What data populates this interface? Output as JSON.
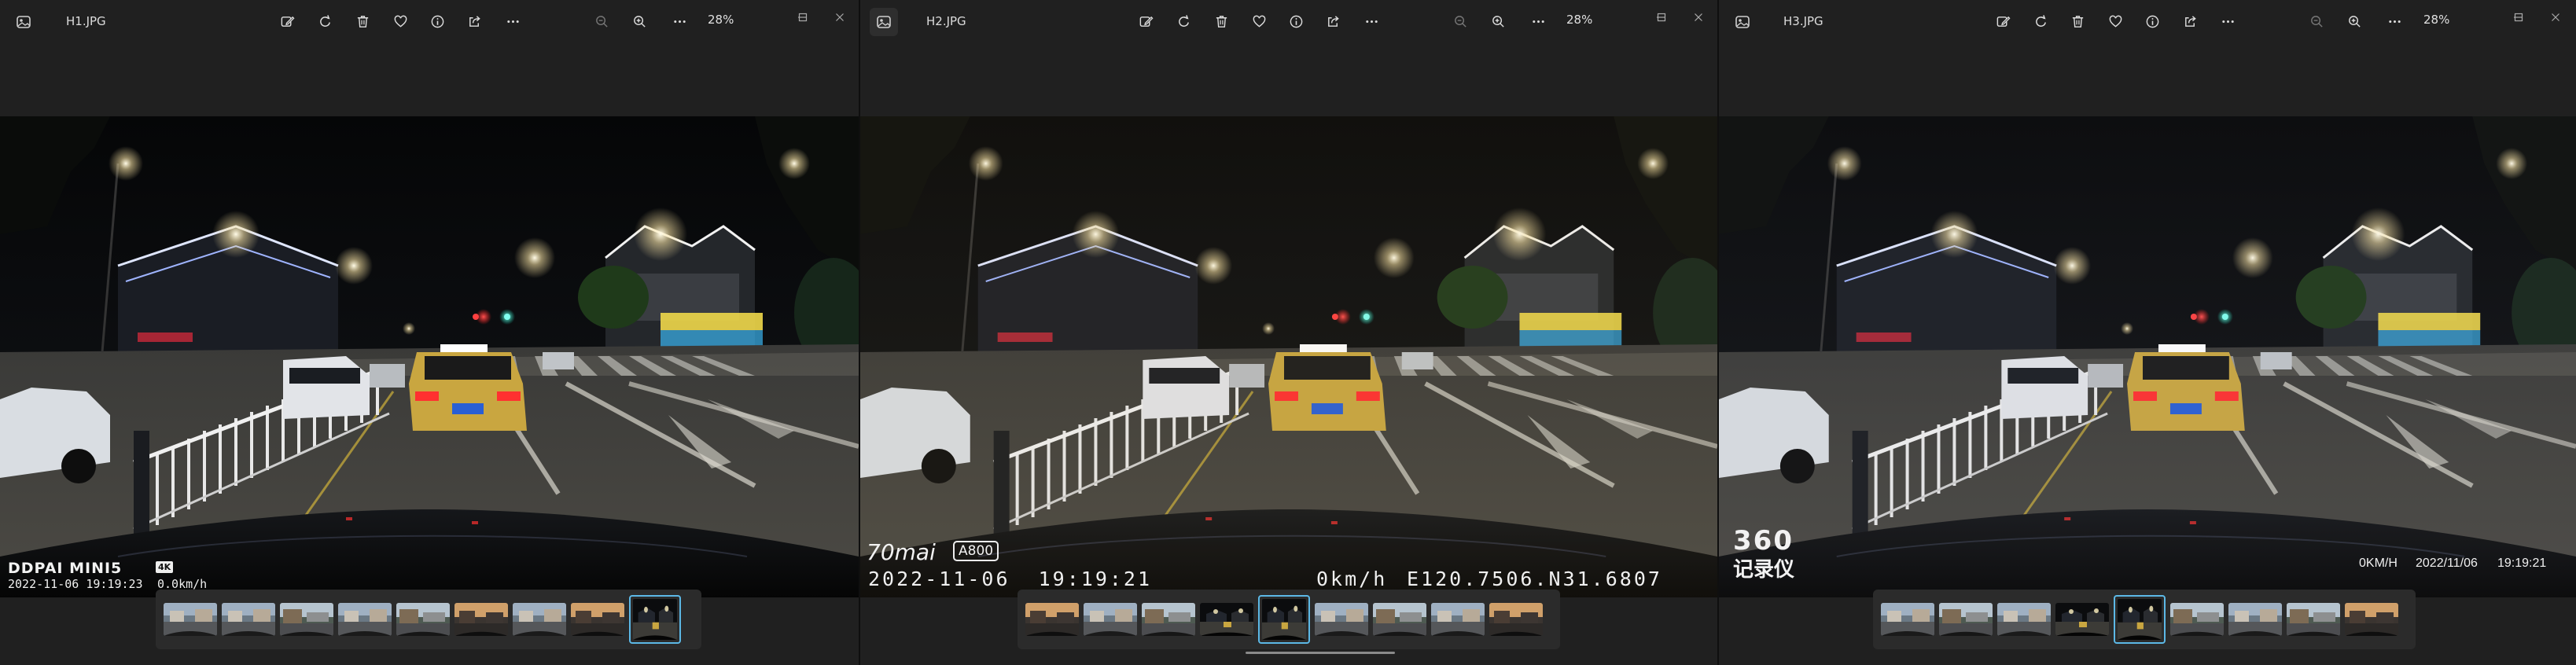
{
  "windows": [
    {
      "filename": "H1.JPG",
      "zoom": "28%",
      "overlay": {
        "brand": "DDPAI MINI5",
        "badge": "4K",
        "datetime": "2022-11-06 19:19:23",
        "speed": "0.0km/h"
      },
      "thumbnail_count": 9,
      "selected_thumbnail": 8
    },
    {
      "filename": "H2.JPG",
      "zoom": "28%",
      "overlay": {
        "brand": "70mai",
        "badge": "A800",
        "datetime": "2022-11-06  19:19:21",
        "speed": "0km/h",
        "coords": "E120.7506.N31.6807"
      },
      "thumbnail_count": 9,
      "selected_thumbnail": 4
    },
    {
      "filename": "H3.JPG",
      "zoom": "28%",
      "overlay": {
        "brand": "360",
        "brand_sub": "记录仪",
        "speed": "0KM/H",
        "date": "2022/11/06",
        "time": "19:19:21"
      },
      "thumbnail_count": 9,
      "selected_thumbnail": 4
    }
  ],
  "toolbar_icons": [
    "edit-icon",
    "rotate-icon",
    "delete-icon",
    "favorite-heart-icon",
    "info-icon",
    "share-icon",
    "more-options-icon"
  ],
  "zoom_icons": [
    "zoom-out-icon",
    "zoom-in-icon",
    "more-options-icon"
  ],
  "window_controls": [
    "minimize-icon",
    "maximize-icon",
    "close-icon"
  ],
  "colors": {
    "background": "#202020",
    "accent": "#5cb8e6",
    "strip": "#2b2b2b"
  }
}
